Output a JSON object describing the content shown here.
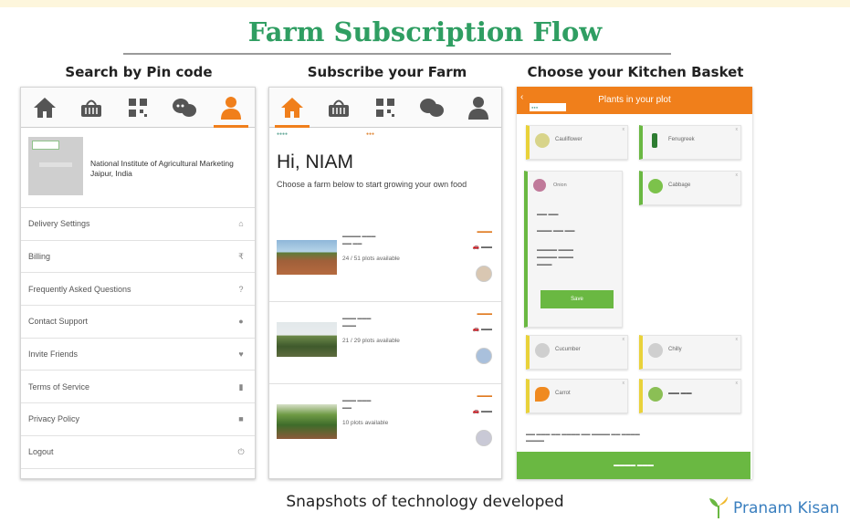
{
  "title": "Farm Subscription Flow",
  "columns": [
    "Search by Pin code",
    "Subscribe your Farm",
    "Choose your Kitchen Basket"
  ],
  "phone1": {
    "profile_name": "National Institute of Agricultural Marketing Jaipur, India",
    "menu": [
      {
        "label": "Delivery Settings",
        "icon": "home-icon"
      },
      {
        "label": "Billing",
        "icon": "rupee-icon"
      },
      {
        "label": "Frequently Asked Questions",
        "icon": "question-icon"
      },
      {
        "label": "Contact Support",
        "icon": "chat-icon"
      },
      {
        "label": "Invite Friends",
        "icon": "heart-icon"
      },
      {
        "label": "Terms of Service",
        "icon": "doc-icon"
      },
      {
        "label": "Privacy Policy",
        "icon": "lock-icon"
      },
      {
        "label": "Logout",
        "icon": "power-icon"
      }
    ]
  },
  "phone2": {
    "greeting": "Hi, NIAM",
    "instruction": "Choose a farm below to start growing your own food",
    "farms": [
      {
        "availability": "24 / 51 plots available"
      },
      {
        "availability": "21 / 29 plots available"
      },
      {
        "availability": "10 plots available"
      }
    ]
  },
  "phone3": {
    "header_title": "Plants in your plot",
    "tiles": [
      "Cauliflower",
      "Fenugreek",
      "Onion",
      "Cabbage",
      "Cucumber",
      "Chilly",
      "Carrot"
    ],
    "save_label": "Save"
  },
  "caption": "Snapshots of technology developed",
  "brand": "Pranam Kisan",
  "colors": {
    "title": "#2f9e62",
    "accent": "#f07f1b",
    "green": "#6ab842"
  }
}
